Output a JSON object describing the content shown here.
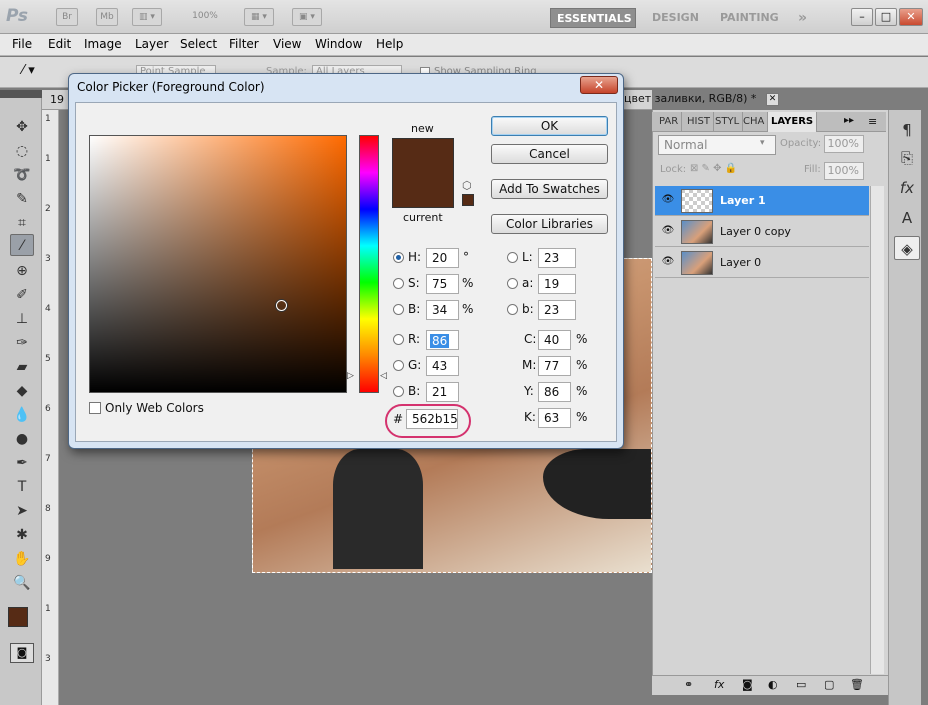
{
  "app": {
    "logo": "Ps",
    "bridge": "Br",
    "minibridge": "Mb",
    "zoom": "100%",
    "workspaces": [
      "ESSENTIALS",
      "DESIGN",
      "PAINTING"
    ],
    "more": "»",
    "win": {
      "min": "–",
      "max": "□",
      "close": "✕"
    }
  },
  "menu": [
    "File",
    "Edit",
    "Image",
    "Layer",
    "Select",
    "Filter",
    "View",
    "Window",
    "Help"
  ],
  "options": {
    "sample_size": "Point Sample",
    "sample": "Sample:",
    "all_layers": "All Layers",
    "show_ring": "Show Sampling Ring"
  },
  "document": {
    "tab_left": "19",
    "tab_right": "цвет заливки, RGB/8) *",
    "tab_close": "✕"
  },
  "ruler": [
    "1",
    "1",
    "2",
    "3",
    "4",
    "5",
    "6",
    "7",
    "8",
    "9",
    "1",
    "3"
  ],
  "dialog": {
    "title": "Color Picker (Foreground Color)",
    "close": "✕",
    "new_label": "new",
    "current_label": "current",
    "buttons": {
      "ok": "OK",
      "cancel": "Cancel",
      "add": "Add To Swatches",
      "libraries": "Color Libraries"
    },
    "web_colors": "Only Web Colors",
    "fields": {
      "H": {
        "label": "H:",
        "value": "20",
        "unit": "°"
      },
      "S": {
        "label": "S:",
        "value": "75",
        "unit": "%"
      },
      "B": {
        "label": "B:",
        "value": "34",
        "unit": "%"
      },
      "R": {
        "label": "R:",
        "value": "86"
      },
      "G": {
        "label": "G:",
        "value": "43"
      },
      "Bl": {
        "label": "B:",
        "value": "21"
      },
      "L": {
        "label": "L:",
        "value": "23"
      },
      "a": {
        "label": "a:",
        "value": "19"
      },
      "b": {
        "label": "b:",
        "value": "23"
      },
      "C": {
        "label": "C:",
        "value": "40",
        "unit": "%"
      },
      "M": {
        "label": "M:",
        "value": "77",
        "unit": "%"
      },
      "Y": {
        "label": "Y:",
        "value": "86",
        "unit": "%"
      },
      "K": {
        "label": "K:",
        "value": "63",
        "unit": "%"
      },
      "hex": {
        "label": "#",
        "value": "562b15"
      }
    },
    "color": "#562b15"
  },
  "panel": {
    "tabs": [
      "PAR",
      "HIST",
      "STYL",
      "CHA",
      "LAYERS"
    ],
    "tab_more": "▸▸",
    "blend_mode": "Normal",
    "opacity_label": "Opacity:",
    "opacity": "100%",
    "lock_label": "Lock:",
    "fill_label": "Fill:",
    "fill": "100%",
    "layers": [
      "Layer 1",
      "Layer 0 copy",
      "Layer 0"
    ]
  },
  "icons": [
    "paragraph-icon",
    "clone-source-icon",
    "fx-icon",
    "character-icon",
    "layers-icon"
  ]
}
